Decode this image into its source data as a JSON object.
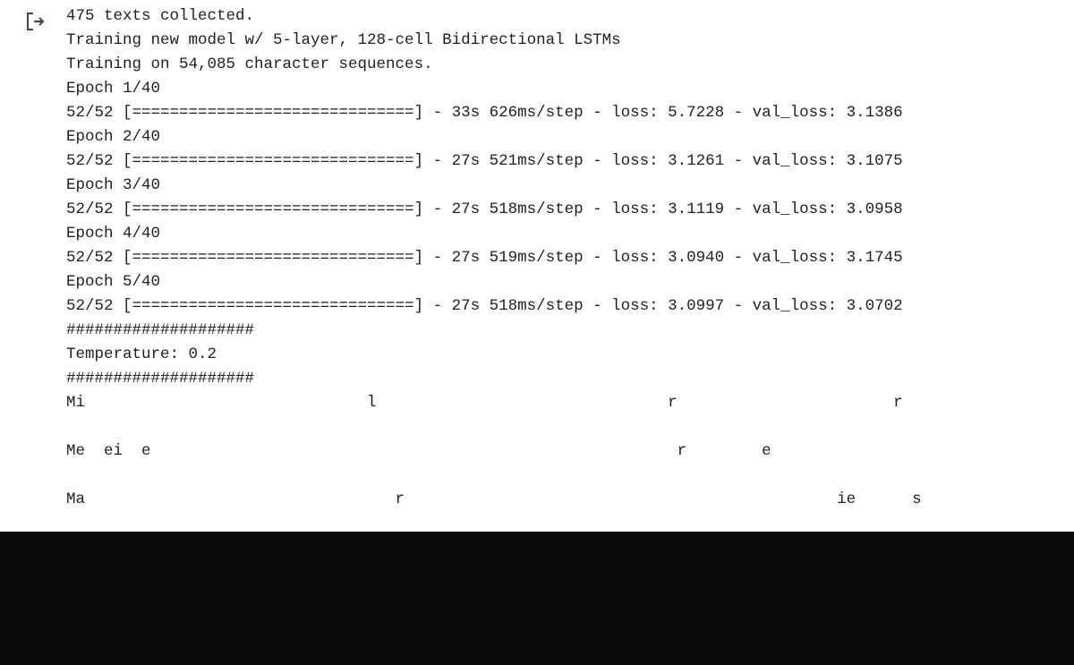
{
  "output_icon": "output-redirect-icon",
  "lines": [
    "475 texts collected.",
    "Training new model w/ 5-layer, 128-cell Bidirectional LSTMs",
    "Training on 54,085 character sequences.",
    "Epoch 1/40",
    "52/52 [==============================] - 33s 626ms/step - loss: 5.7228 - val_loss: 3.1386",
    "Epoch 2/40",
    "52/52 [==============================] - 27s 521ms/step - loss: 3.1261 - val_loss: 3.1075",
    "Epoch 3/40",
    "52/52 [==============================] - 27s 518ms/step - loss: 3.1119 - val_loss: 3.0958",
    "Epoch 4/40",
    "52/52 [==============================] - 27s 519ms/step - loss: 3.0940 - val_loss: 3.1745",
    "Epoch 5/40",
    "52/52 [==============================] - 27s 518ms/step - loss: 3.0997 - val_loss: 3.0702",
    "####################",
    "Temperature: 0.2",
    "####################",
    "Mi                              l                               r                       r",
    "",
    "Me  ei  e                                                        r        e",
    "",
    "Ma                                 r                                              ie      s"
  ]
}
